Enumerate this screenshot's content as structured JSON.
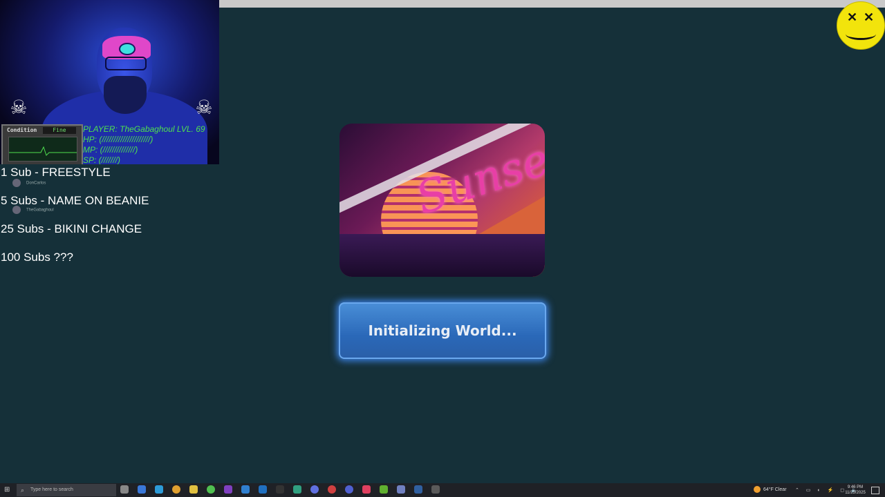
{
  "overlay": {
    "hud": {
      "condition_label": "Condition",
      "condition_value": "Fine",
      "player_line": "PLAYER: TheGabaghoul LVL. 69",
      "hp_line": "HP:   (/////////////////////)",
      "mp_line": "MP:   (//////////////)",
      "sp_line": "SP: (///////)"
    },
    "goals": [
      "1 Sub - FREESTYLE",
      "5 Subs - NAME ON BEANIE",
      "25 Subs - BIKINI CHANGE",
      "100 Subs ???"
    ],
    "chat": [
      {
        "user": "DonCarlos"
      },
      {
        "user": "TheGabaghoul"
      }
    ],
    "logo_icon": "smiley-face-logo"
  },
  "main": {
    "world_thumbnail_text": "Sunset",
    "status_button": "Initializing World..."
  },
  "taskbar": {
    "search_placeholder": "Type here to search",
    "weather": "64°F  Clear",
    "time": "9:46 PM",
    "date": "11/25/2025"
  },
  "colors": {
    "background": "#153039",
    "button": "#2a68b8",
    "hud_text": "#4fe04f",
    "logo": "#f2e40c"
  }
}
